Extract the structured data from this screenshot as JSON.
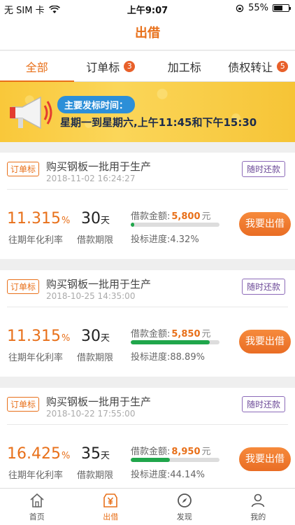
{
  "status": {
    "carrier": "无 SIM 卡",
    "time": "上午9:07",
    "battery": "55%"
  },
  "header": {
    "title": "出借"
  },
  "tabs": [
    {
      "label": "全部",
      "badge": ""
    },
    {
      "label": "订单标",
      "badge": "3"
    },
    {
      "label": "加工标",
      "badge": ""
    },
    {
      "label": "债权转让",
      "badge": "5"
    }
  ],
  "banner": {
    "title": "主要发标时间：",
    "text": "星期一到星期六,上午11:45和下午15:30"
  },
  "loans": [
    {
      "tag": "订单标",
      "title": "购买钢板一批用于生产",
      "date": "2018-11-02 16:24:27",
      "repay": "随时还款",
      "rate": "11.315",
      "rate_unit": "%",
      "rate_label": "往期年化利率",
      "term": "30",
      "term_unit": "天",
      "term_label": "借款期限",
      "amount_label": "借款金额:",
      "amount": "5,800",
      "amount_unit": "元",
      "progress_label": "投标进度:4.32%",
      "progress": 4.32,
      "button": "我要出借"
    },
    {
      "tag": "订单标",
      "title": "购买钢板一批用于生产",
      "date": "2018-10-25 14:35:00",
      "repay": "随时还款",
      "rate": "11.315",
      "rate_unit": "%",
      "rate_label": "往期年化利率",
      "term": "30",
      "term_unit": "天",
      "term_label": "借款期限",
      "amount_label": "借款金额:",
      "amount": "5,850",
      "amount_unit": "元",
      "progress_label": "投标进度:88.89%",
      "progress": 88.89,
      "button": "我要出借"
    },
    {
      "tag": "订单标",
      "title": "购买钢板一批用于生产",
      "date": "2018-10-22 17:55:00",
      "repay": "随时还款",
      "rate": "16.425",
      "rate_unit": "%",
      "rate_label": "往期年化利率",
      "term": "35",
      "term_unit": "天",
      "term_label": "借款期限",
      "amount_label": "借款金额:",
      "amount": "8,950",
      "amount_unit": "元",
      "progress_label": "投标进度:44.14%",
      "progress": 44.14,
      "button": "我要出借"
    }
  ],
  "tabbar": [
    {
      "label": "首页",
      "icon": "home-icon"
    },
    {
      "label": "出借",
      "icon": "yuan-icon"
    },
    {
      "label": "发现",
      "icon": "compass-icon"
    },
    {
      "label": "我的",
      "icon": "user-icon"
    }
  ]
}
